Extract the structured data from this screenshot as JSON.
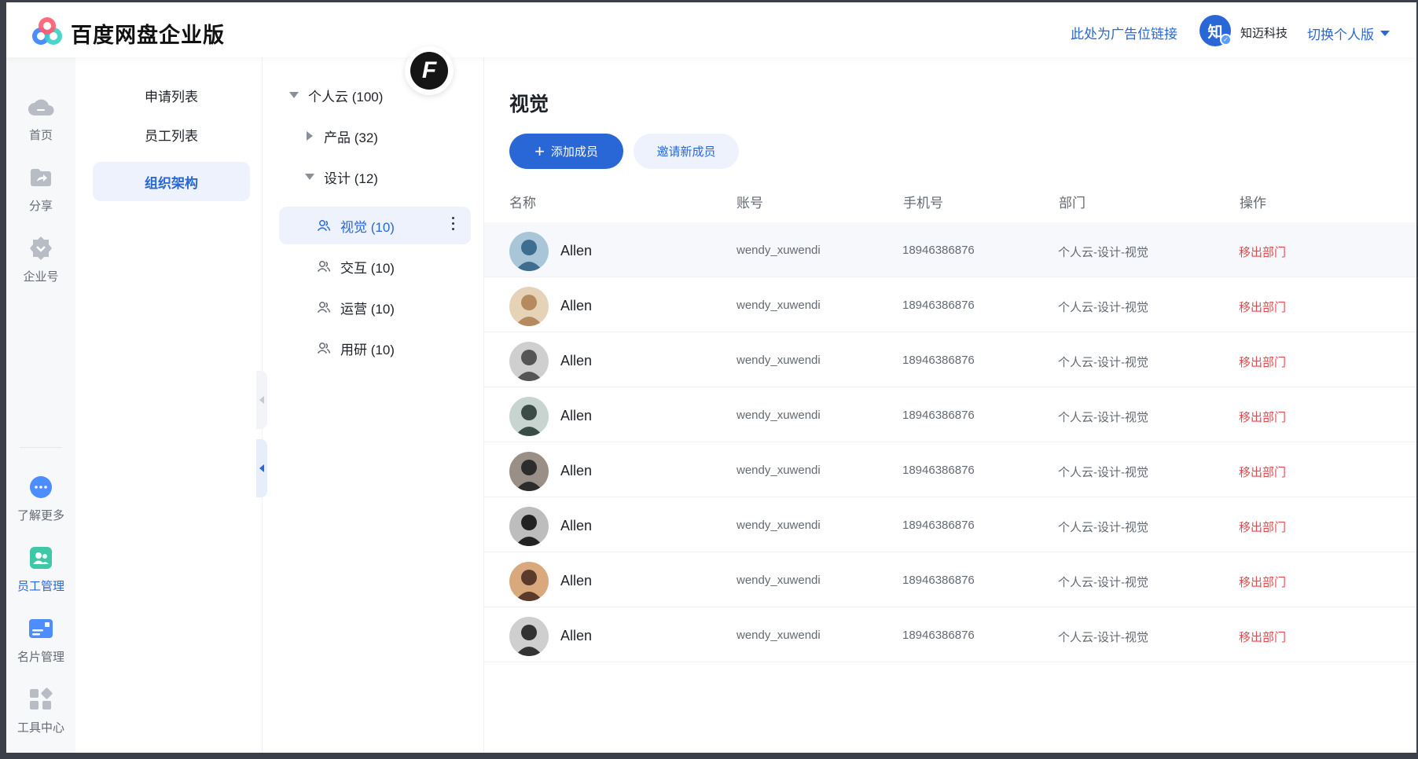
{
  "header": {
    "brand": "百度网盘企业版",
    "ad_link": "此处为广告位链接",
    "org_avatar_char": "知",
    "org_name": "知迈科技",
    "switch_label": "切换个人版"
  },
  "nav": {
    "items": [
      {
        "label": "首页",
        "icon": "cloud-icon"
      },
      {
        "label": "分享",
        "icon": "share-folder-icon"
      },
      {
        "label": "企业号",
        "icon": "enterprise-badge-icon"
      },
      {
        "label": "了解更多",
        "icon": "more-chat-icon"
      },
      {
        "label": "员工管理",
        "icon": "staff-icon"
      },
      {
        "label": "名片管理",
        "icon": "card-icon"
      },
      {
        "label": "工具中心",
        "icon": "tools-icon"
      }
    ],
    "active": "员工管理"
  },
  "submenu": {
    "items": [
      "申请列表",
      "员工列表",
      "组织架构"
    ],
    "active": "组织架构"
  },
  "tree": {
    "root": "个人云 (100)",
    "nodes": [
      "产品 (32)",
      "设计 (12)"
    ],
    "groups": [
      "视觉 (10)",
      "交互 (10)",
      "运营 (10)",
      "用研 (10)"
    ],
    "selected": "视觉 (10)"
  },
  "main": {
    "title": "视觉",
    "add_button": "添加成员",
    "invite_button": "邀请新成员",
    "columns": [
      "名称",
      "账号",
      "手机号",
      "部门",
      "操作"
    ],
    "rows": [
      {
        "name": "Allen",
        "account": "wendy_xuwendi",
        "phone": "18946386876",
        "dept": "个人云-设计-视觉",
        "action": "移出部门"
      },
      {
        "name": "Allen",
        "account": "wendy_xuwendi",
        "phone": "18946386876",
        "dept": "个人云-设计-视觉",
        "action": "移出部门"
      },
      {
        "name": "Allen",
        "account": "wendy_xuwendi",
        "phone": "18946386876",
        "dept": "个人云-设计-视觉",
        "action": "移出部门"
      },
      {
        "name": "Allen",
        "account": "wendy_xuwendi",
        "phone": "18946386876",
        "dept": "个人云-设计-视觉",
        "action": "移出部门"
      },
      {
        "name": "Allen",
        "account": "wendy_xuwendi",
        "phone": "18946386876",
        "dept": "个人云-设计-视觉",
        "action": "移出部门"
      },
      {
        "name": "Allen",
        "account": "wendy_xuwendi",
        "phone": "18946386876",
        "dept": "个人云-设计-视觉",
        "action": "移出部门"
      },
      {
        "name": "Allen",
        "account": "wendy_xuwendi",
        "phone": "18946386876",
        "dept": "个人云-设计-视觉",
        "action": "移出部门"
      },
      {
        "name": "Allen",
        "account": "wendy_xuwendi",
        "phone": "18946386876",
        "dept": "个人云-设计-视觉",
        "action": "移出部门"
      }
    ]
  },
  "colors": {
    "accent": "#2a67d6",
    "danger": "#e5484d",
    "selected_bg": "#edf2fc"
  }
}
